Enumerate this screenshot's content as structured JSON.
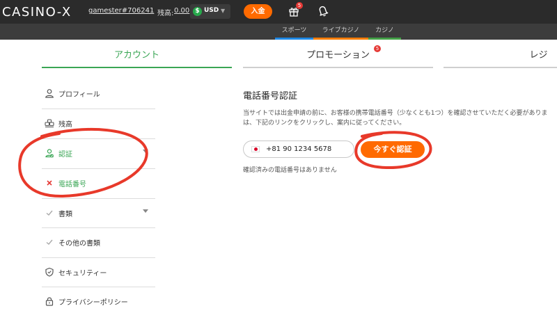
{
  "header": {
    "logo": "CASINO-X",
    "username": "gamester#706241",
    "balance_label": "残高:",
    "balance_value": "0.00",
    "currency_symbol": "$",
    "currency": "USD",
    "deposit_label": "入金",
    "gift_badge": "5"
  },
  "subnav": {
    "tabs": [
      {
        "label": "スポーツ",
        "color": "#1e88e5"
      },
      {
        "label": "ライブカジノ",
        "color": "#f57c00"
      },
      {
        "label": "カジノ",
        "color": "#43a047"
      }
    ]
  },
  "tabs": {
    "account": "アカウント",
    "promotion": "プロモーション",
    "promotion_badge": "5",
    "register": "レジ",
    "active_color": "#3aa655"
  },
  "sidebar": {
    "items": [
      {
        "label": "プロフィール",
        "icon": "user-icon"
      },
      {
        "label": "残高",
        "icon": "coins-icon"
      },
      {
        "label": "認証",
        "icon": "verify-icon",
        "active": true
      },
      {
        "label": "電話番号",
        "icon": "cross-icon",
        "active": true
      },
      {
        "label": "書類",
        "icon": "check-icon"
      },
      {
        "label": "その他の書類",
        "icon": "check-icon"
      },
      {
        "label": "セキュリティー",
        "icon": "shield-icon"
      },
      {
        "label": "プライバシーポリシー",
        "icon": "lock-icon"
      }
    ]
  },
  "content": {
    "title": "電話番号認証",
    "desc_line1": "当サイトでは出金申請の前に、お客様の携帯電話番号（少なくとも1つ）を確認させていただく必要がありま",
    "desc_line2": "は、下記のリンクをクリックし、案内に従ってください。",
    "phone_value": "+81 90 1234 5678",
    "verify_label": "今すぐ認証",
    "no_phone_text": "確認済みの電話番号はありません"
  },
  "colors": {
    "accent_orange": "#ff6a00",
    "active_green": "#3aa655",
    "annotation_red": "#e8392a"
  }
}
